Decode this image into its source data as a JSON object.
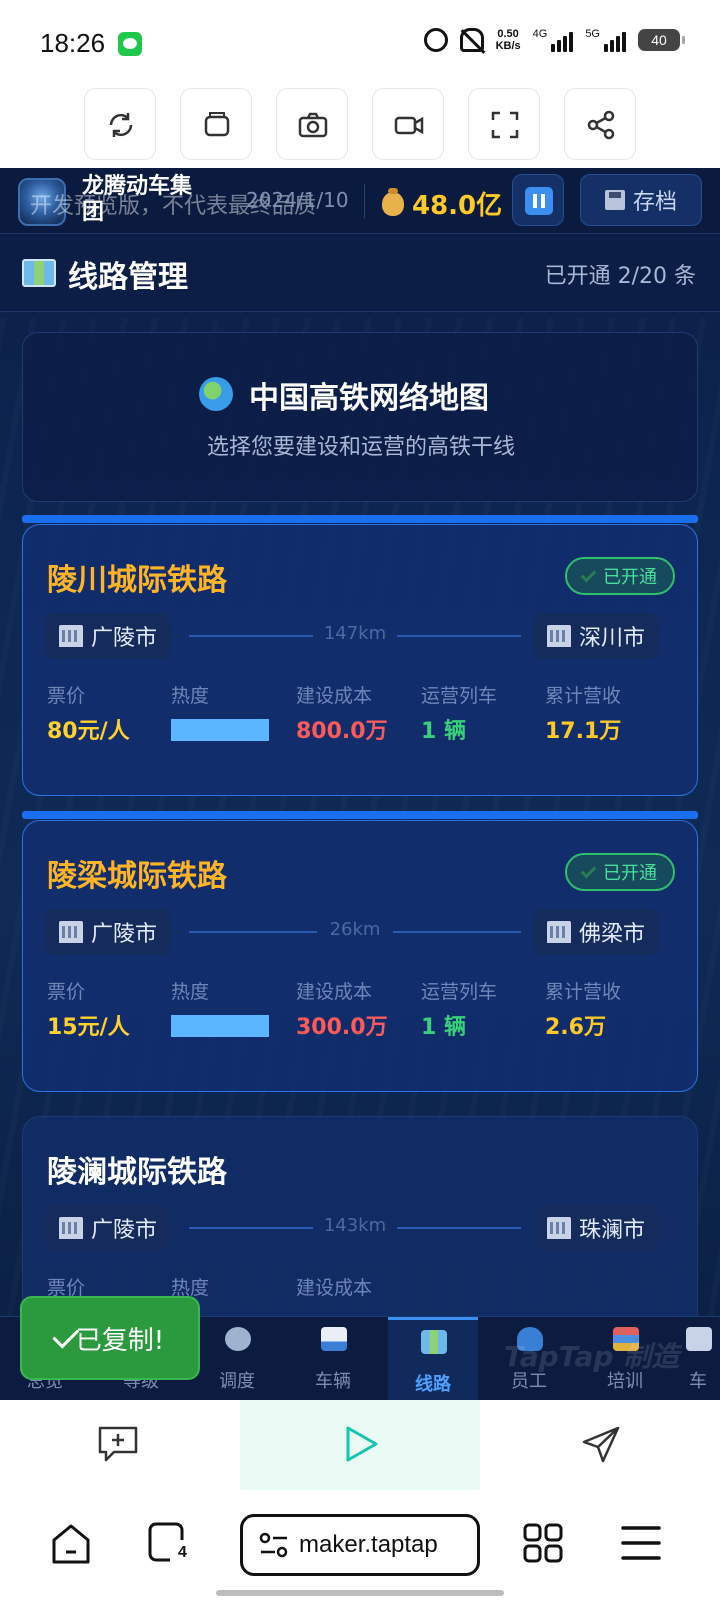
{
  "status_bar": {
    "time": "18:26",
    "net_speed": "0.50",
    "net_unit": "KB/s",
    "sig1": "4G",
    "sig2": "5G",
    "battery": "40"
  },
  "game": {
    "company": "龙腾动车集团",
    "watermark": "开发预览版，不代表最终品质",
    "date": "2024/1/10",
    "money": "48.0亿",
    "save_label": "存档",
    "section_title": "线路管理",
    "section_count": "已开通 2/20 条",
    "map_title": "中国高铁网络地图",
    "map_subtitle": "选择您要建设和运营的高铁干线",
    "stat_labels": [
      "票价",
      "热度",
      "建设成本",
      "运营列车",
      "累计营收"
    ],
    "routes": [
      {
        "name": "陵川城际铁路",
        "status": "已开通",
        "from": "广陵市",
        "to": "深川市",
        "distance": "147km",
        "price": "80元/人",
        "heat": 1.0,
        "cost": "800.0万",
        "trains": "1 辆",
        "revenue": "17.1万"
      },
      {
        "name": "陵梁城际铁路",
        "status": "已开通",
        "from": "广陵市",
        "to": "佛梁市",
        "distance": "26km",
        "price": "15元/人",
        "heat": 1.0,
        "cost": "300.0万",
        "trains": "1 辆",
        "revenue": "2.6万"
      },
      {
        "name": "陵澜城际铁路",
        "from": "广陵市",
        "to": "珠澜市",
        "distance": "143km"
      }
    ],
    "tabs": [
      "总览",
      "等级",
      "调度",
      "车辆",
      "线路",
      "员工",
      "培训",
      "车"
    ],
    "active_tab": "线路",
    "toast": "已复制!",
    "taptap_mark": "TapTap 制造"
  },
  "colors": {
    "price": "#ffd02e",
    "cost": "#ff5a5a",
    "trains": "#35d27a",
    "revenue": "#ffc928",
    "accent": "#1a6ff0"
  },
  "browser": {
    "url": "maker.taptap",
    "tab_count": "4"
  }
}
